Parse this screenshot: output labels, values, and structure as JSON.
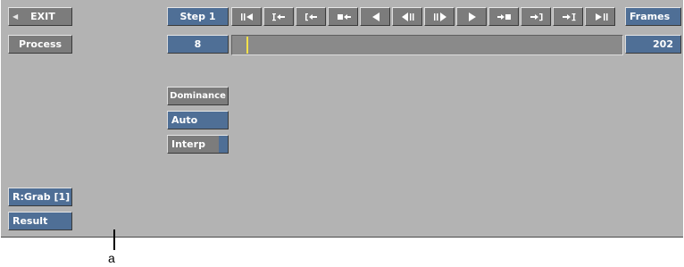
{
  "left": {
    "exit_label": "EXIT",
    "process_label": "Process",
    "rgrab_label": "R:Grab [1]",
    "result_label": "Result"
  },
  "toolbar": {
    "step_label": "Step 1",
    "step_value": "8",
    "frames_label": "Frames",
    "frames_value": "202",
    "transport": [
      "go-to-start-icon",
      "go-to-in-point-icon",
      "previous-keyframe-icon",
      "previous-marker-icon",
      "play-reverse-icon",
      "step-back-frame-icon",
      "step-forward-frame-icon",
      "play-icon",
      "next-marker-icon",
      "next-keyframe-icon",
      "go-to-out-point-icon",
      "go-to-end-icon"
    ]
  },
  "controls": {
    "dominance_label": "Dominance",
    "auto_label": "Auto",
    "interp_label": "Interp"
  },
  "annotation": {
    "label": "a"
  },
  "colors": {
    "panel": "#b3b3b3",
    "button_gray": "#7c7c7c",
    "button_blue": "#4f6f96",
    "cursor": "#f2e04a"
  }
}
